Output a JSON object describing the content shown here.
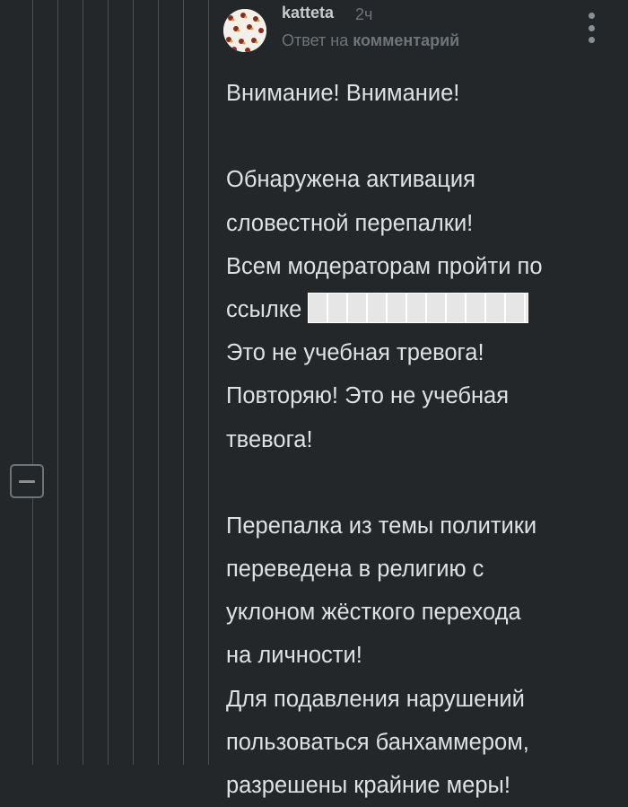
{
  "comment": {
    "author": "katteta",
    "time_ago": "2ч",
    "reply_prefix": "Ответ на",
    "reply_link": "комментарий",
    "lines": [
      "Внимание! Внимание!",
      "",
      "Обнаружена активация",
      "словестной перепалки!",
      "Всем модераторам пройти по",
      "ссылке",
      "Это не учебная тревога!",
      "Повторяю! Это не учебная",
      "твевога!",
      "",
      "Перепалка из темы политики",
      "переведена в религию с",
      "уклоном жёсткого перехода",
      "на личности!",
      "Для подавления нарушений",
      "пользоваться банхаммером,",
      "разрешены крайние меры!"
    ]
  },
  "icons": {
    "collapse": "minus-square-icon",
    "more": "vertical-dots-icon",
    "avatar": "patterned-avatar"
  },
  "colors": {
    "background": "#24272a",
    "text": "#dfe1e3",
    "muted": "#6f7478",
    "thread_line": "#4a4e52"
  }
}
